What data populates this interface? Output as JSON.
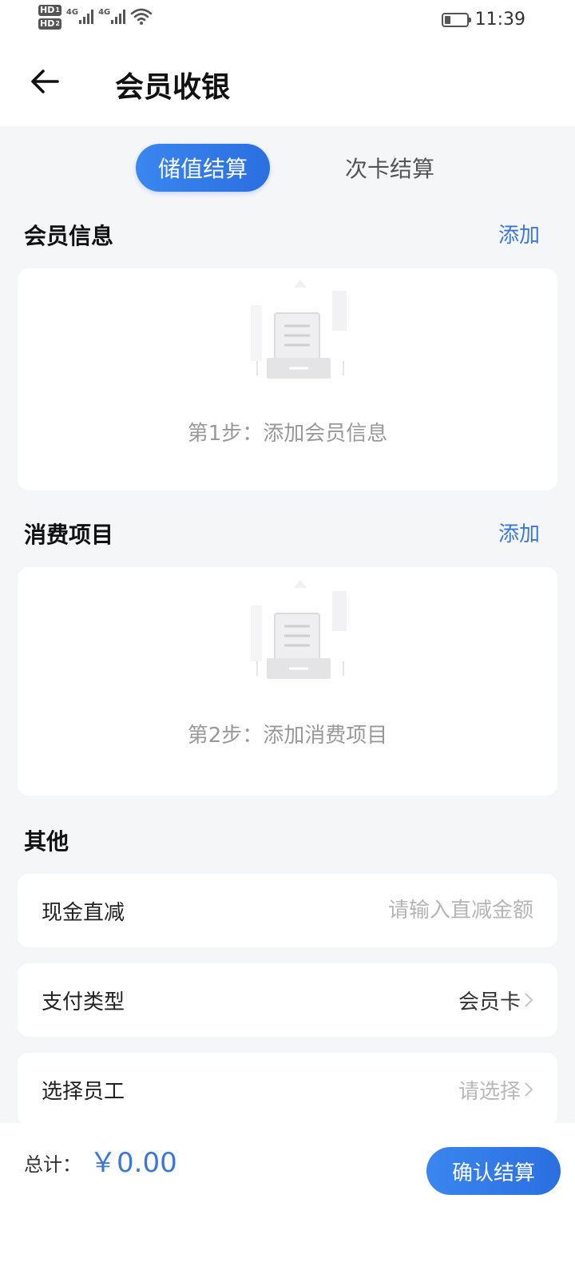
{
  "status_bar": {
    "sim1": "HD",
    "sim1_index": "1",
    "sim2": "HD",
    "sim2_index": "2",
    "network1": "4G",
    "network2": "4G",
    "time": "11:39",
    "battery_level": 0.3
  },
  "header": {
    "title": "会员收银"
  },
  "tabs": [
    {
      "label": "储值结算",
      "active": true
    },
    {
      "label": "次卡结算",
      "active": false
    }
  ],
  "member_section": {
    "title": "会员信息",
    "add_label": "添加",
    "empty_text": "第1步：添加会员信息"
  },
  "items_section": {
    "title": "消费项目",
    "add_label": "添加",
    "empty_text": "第2步：添加消费项目"
  },
  "other_section": {
    "title": "其他",
    "rows": [
      {
        "label": "现金直减",
        "placeholder": "请输入直减金额"
      },
      {
        "label": "支付类型",
        "value": "会员卡"
      },
      {
        "label": "选择员工",
        "placeholder": "请选择"
      }
    ]
  },
  "footer": {
    "total_label": "总计：",
    "total_value": "￥0.00",
    "confirm_label": "确认结算"
  },
  "colors": {
    "accent": "#2b6fe0",
    "link": "#3a78d8",
    "background": "#f5f6f8"
  },
  "icons": {
    "back": "arrow-left-icon",
    "empty": "empty-document-icon",
    "chevron": "chevron-right-icon"
  }
}
